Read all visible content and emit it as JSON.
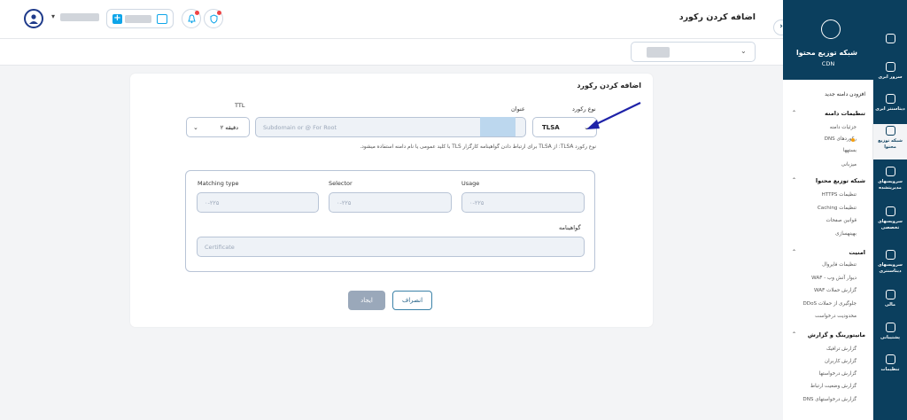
{
  "header": {
    "page_title": "اضافه کردن رکورد"
  },
  "card": {
    "title": "اضافه کردن رکورد",
    "record_type_label": "نوع رکورد",
    "record_type_value": "TLSA",
    "name_label": "عنوان",
    "name_placeholder": "Subdomain or @ For Root",
    "ttl_label": "TTL",
    "ttl_value": "۲ دقیقه",
    "hint": "نوع رکورد TLSA: از TLSA برای ارتباط دادن گواهینامه کارگزار TLS با کلید عمومی یا نام دامنه استفاده میشود.",
    "usage_label": "Usage",
    "usage_placeholder": "۰-۲۲۵",
    "selector_label": "Selector",
    "selector_placeholder": "۰-۲۲۵",
    "matching_label": "Matching type",
    "matching_placeholder": "۰-۲۲۵",
    "certificate_label": "گواهینامه",
    "certificate_placeholder": "Certificate",
    "create_button": "ایجاد",
    "cancel_button": "انصراف"
  },
  "sidebar": {
    "brand_title": "شبکه توزیع محتوا",
    "brand_sub": "CDN",
    "menu": [
      {
        "label": "افزودن دامنه جدید",
        "type": "item"
      },
      {
        "label": "تنظیمات دامنه",
        "type": "section"
      },
      {
        "label": "جزئیات دامنه",
        "type": "sub"
      },
      {
        "label": "رکوردهای DNS",
        "type": "sub"
      },
      {
        "label": "بستهها",
        "type": "sub"
      },
      {
        "label": "میزبانی",
        "type": "sub"
      },
      {
        "label": "شبکه توزیع محتوا",
        "type": "section"
      },
      {
        "label": "تنظیمات HTTPS",
        "type": "sub"
      },
      {
        "label": "تنظیمات Caching",
        "type": "sub"
      },
      {
        "label": "قوانین صفحات",
        "type": "sub"
      },
      {
        "label": "بهینهسازی",
        "type": "sub"
      },
      {
        "label": "امنیت",
        "type": "section"
      },
      {
        "label": "تنظیمات فایروال",
        "type": "sub"
      },
      {
        "label": "دیوار آتش وب - WAF",
        "type": "sub"
      },
      {
        "label": "گزارش حملات WAF",
        "type": "sub"
      },
      {
        "label": "جلوگیری از حملات DDoS",
        "type": "sub"
      },
      {
        "label": "محدودیت درخواست",
        "type": "sub"
      },
      {
        "label": "مانیتورینگ و گزارش",
        "type": "section"
      },
      {
        "label": "گزارش ترافیک",
        "type": "sub"
      },
      {
        "label": "گزارش کاربران",
        "type": "sub"
      },
      {
        "label": "گزارش درخواستها",
        "type": "sub"
      },
      {
        "label": "گزارش وضعیت ارتباط",
        "type": "sub"
      },
      {
        "label": "گزارش درخواستهای DNS",
        "type": "sub"
      }
    ],
    "rail": [
      {
        "label": "",
        "icon": "home-icon"
      },
      {
        "label": "سرور ابری",
        "icon": "cloud-server-icon"
      },
      {
        "label": "دیتاسنتر ابری",
        "icon": "datacenter-icon"
      },
      {
        "label": "شبکه توزیع محتوا",
        "icon": "cdn-icon"
      },
      {
        "label": "سرویسهای مدیریتشده",
        "icon": "managed-services-icon"
      },
      {
        "label": "سرویسهای تخصصی",
        "icon": "specialized-services-icon"
      },
      {
        "label": "سرویسهای دیتاسنتری",
        "icon": "datacenter-services-icon"
      },
      {
        "label": "مالی",
        "icon": "finance-icon"
      },
      {
        "label": "پشتیبانی",
        "icon": "support-icon"
      },
      {
        "label": "تنظیمات",
        "icon": "settings-icon"
      }
    ]
  }
}
